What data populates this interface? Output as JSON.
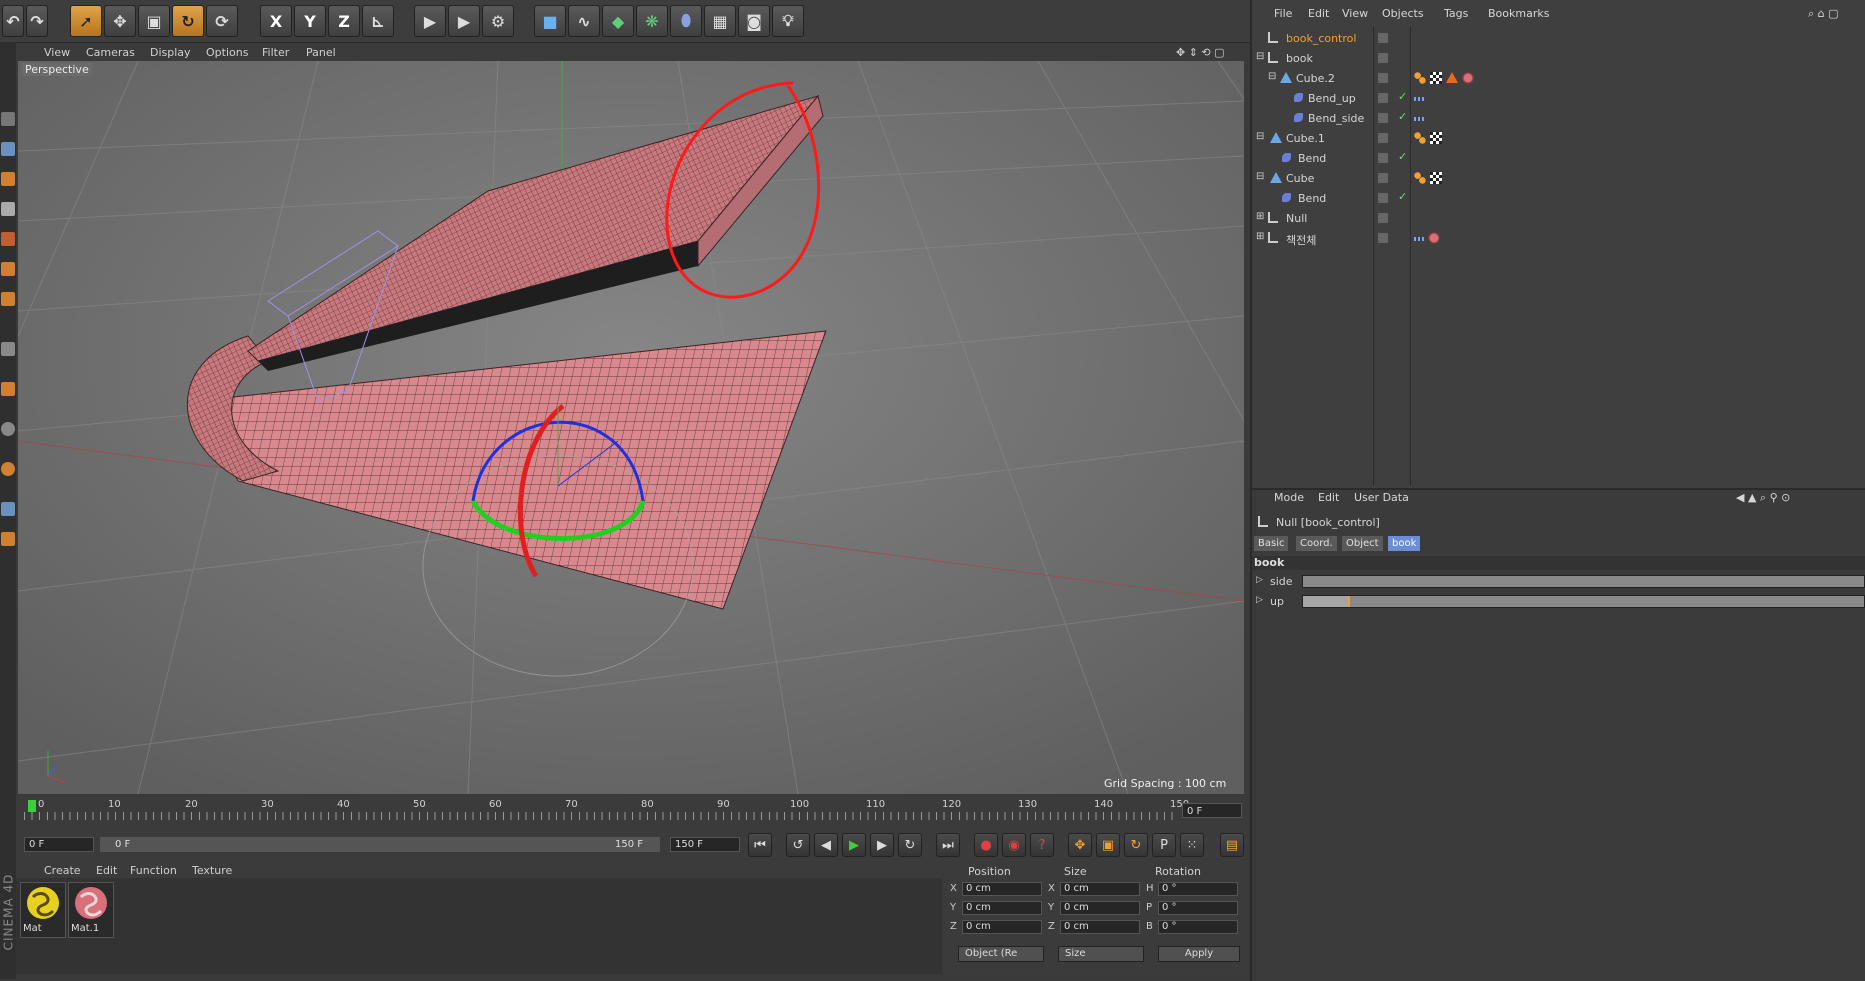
{
  "toolbar": {
    "axis_x": "X",
    "axis_y": "Y",
    "axis_z": "Z"
  },
  "viewport": {
    "menu": [
      "View",
      "Cameras",
      "Display",
      "Options",
      "Filter",
      "Panel"
    ],
    "label": "Perspective",
    "grid_spacing": "Grid Spacing : 100 cm"
  },
  "timeline": {
    "ticks": [
      "0",
      "10",
      "20",
      "30",
      "40",
      "50",
      "60",
      "70",
      "80",
      "90",
      "100",
      "110",
      "120",
      "130",
      "140",
      "150"
    ],
    "current_frame": "0 F"
  },
  "playback": {
    "start": "0 F",
    "range_start": "0 F",
    "range_end": "150 F",
    "end": "150 F"
  },
  "materials": {
    "menu": [
      "Create",
      "Edit",
      "Function",
      "Texture"
    ],
    "items": [
      {
        "name": "Mat"
      },
      {
        "name": "Mat.1"
      }
    ]
  },
  "coordinates": {
    "headers": [
      "Position",
      "Size",
      "Rotation"
    ],
    "rows": [
      {
        "axis": "X",
        "pos": "0 cm",
        "size_axis": "X",
        "size": "0 cm",
        "rot_axis": "H",
        "rot": "0 °"
      },
      {
        "axis": "Y",
        "pos": "0 cm",
        "size_axis": "Y",
        "size": "0 cm",
        "rot_axis": "P",
        "rot": "0 °"
      },
      {
        "axis": "Z",
        "pos": "0 cm",
        "size_axis": "Z",
        "size": "0 cm",
        "rot_axis": "B",
        "rot": "0 °"
      }
    ],
    "mode_select": "Object (Re",
    "size_select": "Size",
    "apply": "Apply"
  },
  "objects": {
    "menu": [
      "File",
      "Edit",
      "View",
      "Objects",
      "Tags",
      "Bookmarks"
    ],
    "items": [
      {
        "name": "book_control",
        "type": "null",
        "selected": true
      },
      {
        "name": "book",
        "type": "null"
      },
      {
        "name": "Cube.2",
        "type": "cube"
      },
      {
        "name": "Bend_up",
        "type": "bend"
      },
      {
        "name": "Bend_side",
        "type": "bend"
      },
      {
        "name": "Cube.1",
        "type": "cube"
      },
      {
        "name": "Bend",
        "type": "bend"
      },
      {
        "name": "Cube",
        "type": "cube"
      },
      {
        "name": "Bend",
        "type": "bend"
      },
      {
        "name": "Null",
        "type": "null"
      },
      {
        "name": "책전체",
        "type": "null"
      }
    ]
  },
  "attributes": {
    "menu": [
      "Mode",
      "Edit",
      "User Data"
    ],
    "object_title": "Null [book_control]",
    "tabs": [
      "Basic",
      "Coord.",
      "Object",
      "book"
    ],
    "active_tab": "book",
    "group": "book",
    "params": [
      {
        "name": "side",
        "value_fraction": 0.0
      },
      {
        "name": "up",
        "value_fraction": 0.08
      }
    ]
  },
  "brand": "CINEMA 4D",
  "colors": {
    "accent": "#f0a030",
    "mesh": "#d78a8f",
    "annotation": "#ff2020"
  }
}
